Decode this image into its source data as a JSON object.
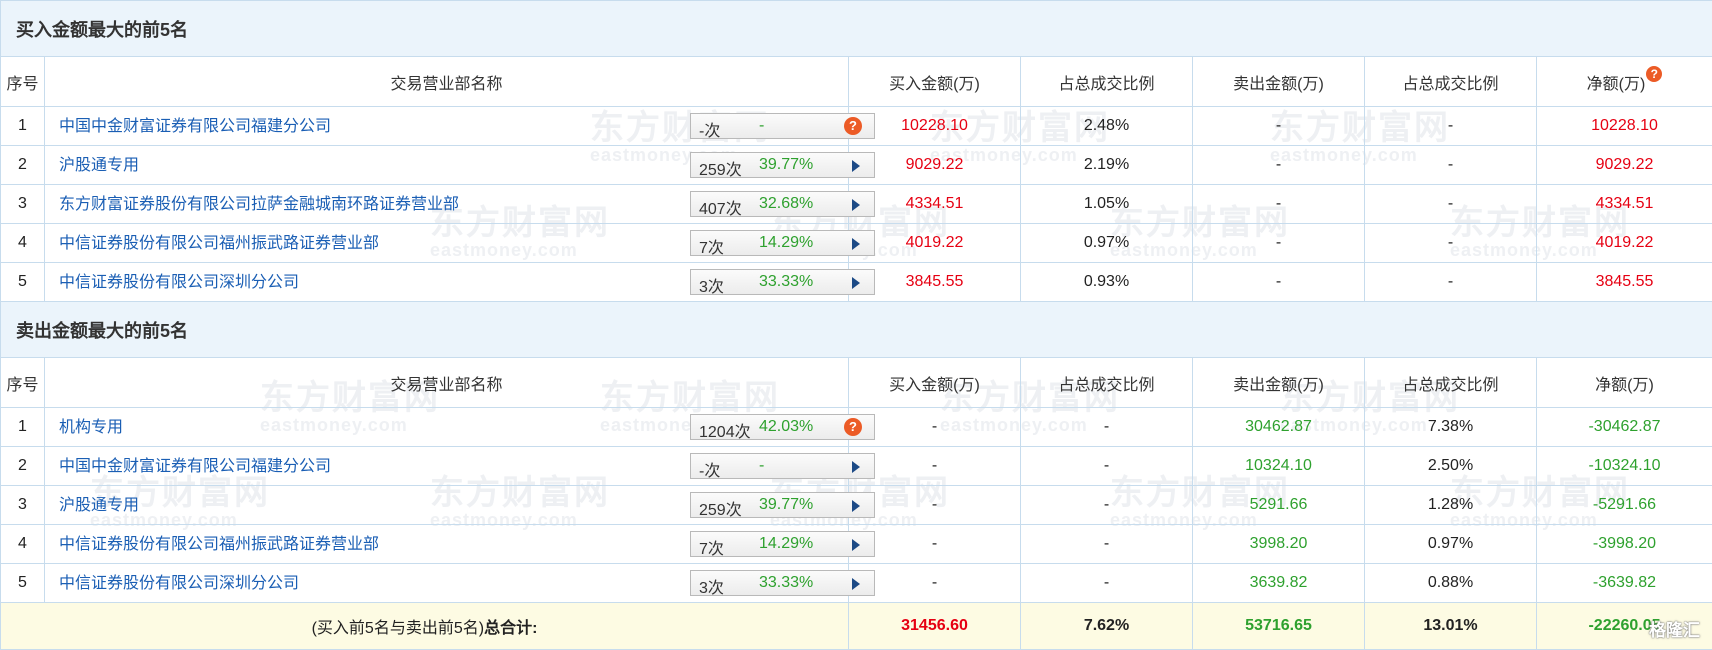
{
  "buy_section": {
    "title": "买入金额最大的前5名",
    "headers": {
      "idx": "序号",
      "name": "交易营业部名称",
      "buy": "买入金额(万)",
      "buy_pct": "占总成交比例",
      "sell": "卖出金额(万)",
      "sell_pct": "占总成交比例",
      "net": "净额(万)"
    },
    "rows": [
      {
        "idx": "1",
        "name": "中国中金财富证券有限公司福建分公司",
        "count": "-次",
        "rate": "-",
        "buy": "10228.10",
        "buy_pct": "2.48%",
        "sell": "-",
        "sell_pct": "-",
        "net": "10228.10"
      },
      {
        "idx": "2",
        "name": "沪股通专用",
        "count": "259次",
        "rate": "39.77%",
        "buy": "9029.22",
        "buy_pct": "2.19%",
        "sell": "-",
        "sell_pct": "-",
        "net": "9029.22"
      },
      {
        "idx": "3",
        "name": "东方财富证券股份有限公司拉萨金融城南环路证券营业部",
        "count": "407次",
        "rate": "32.68%",
        "buy": "4334.51",
        "buy_pct": "1.05%",
        "sell": "-",
        "sell_pct": "-",
        "net": "4334.51"
      },
      {
        "idx": "4",
        "name": "中信证券股份有限公司福州振武路证券营业部",
        "count": "7次",
        "rate": "14.29%",
        "buy": "4019.22",
        "buy_pct": "0.97%",
        "sell": "-",
        "sell_pct": "-",
        "net": "4019.22"
      },
      {
        "idx": "5",
        "name": "中信证券股份有限公司深圳分公司",
        "count": "3次",
        "rate": "33.33%",
        "buy": "3845.55",
        "buy_pct": "0.93%",
        "sell": "-",
        "sell_pct": "-",
        "net": "3845.55"
      }
    ]
  },
  "sell_section": {
    "title": "卖出金额最大的前5名",
    "headers": {
      "idx": "序号",
      "name": "交易营业部名称",
      "buy": "买入金额(万)",
      "buy_pct": "占总成交比例",
      "sell": "卖出金额(万)",
      "sell_pct": "占总成交比例",
      "net": "净额(万)"
    },
    "rows": [
      {
        "idx": "1",
        "name": "机构专用",
        "count": "1204次",
        "rate": "42.03%",
        "buy": "-",
        "buy_pct": "-",
        "sell": "30462.87",
        "sell_pct": "7.38%",
        "net": "-30462.87"
      },
      {
        "idx": "2",
        "name": "中国中金财富证券有限公司福建分公司",
        "count": "-次",
        "rate": "-",
        "buy": "-",
        "buy_pct": "-",
        "sell": "10324.10",
        "sell_pct": "2.50%",
        "net": "-10324.10"
      },
      {
        "idx": "3",
        "name": "沪股通专用",
        "count": "259次",
        "rate": "39.77%",
        "buy": "-",
        "buy_pct": "-",
        "sell": "5291.66",
        "sell_pct": "1.28%",
        "net": "-5291.66"
      },
      {
        "idx": "4",
        "name": "中信证券股份有限公司福州振武路证券营业部",
        "count": "7次",
        "rate": "14.29%",
        "buy": "-",
        "buy_pct": "-",
        "sell": "3998.20",
        "sell_pct": "0.97%",
        "net": "-3998.20"
      },
      {
        "idx": "5",
        "name": "中信证券股份有限公司深圳分公司",
        "count": "3次",
        "rate": "33.33%",
        "buy": "-",
        "buy_pct": "-",
        "sell": "3639.82",
        "sell_pct": "0.88%",
        "net": "-3639.82"
      }
    ]
  },
  "total": {
    "label_pre": "(买入前5名与卖出前5名)",
    "label_bold": "总合计:",
    "buy": "31456.60",
    "buy_pct": "7.62%",
    "sell": "53716.65",
    "sell_pct": "13.01%",
    "net": "-22260.05"
  },
  "help_glyph": "?",
  "watermark": {
    "cn": "东方财富网",
    "en": "eastmoney.com"
  },
  "brand": "格隆汇",
  "icons": {
    "info": "question-badge-icon",
    "arrow": "play-arrow-icon"
  },
  "colors": {
    "positive": "#e60012",
    "negative": "#2ea12e",
    "link": "#1a5eb4",
    "badge": "#ec5b26",
    "section_bg": "#ebf4fb",
    "total_bg": "#fdfbe3",
    "border": "#c7dced"
  }
}
